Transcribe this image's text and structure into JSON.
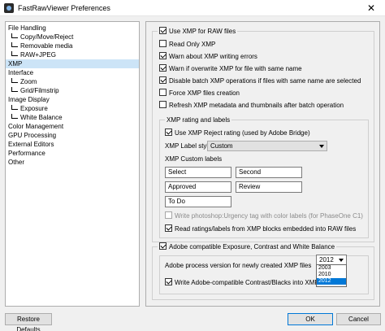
{
  "window": {
    "title": "FastRawViewer Preferences",
    "close": "✕"
  },
  "tree": [
    {
      "label": "File Handling",
      "child": false
    },
    {
      "label": "Copy/Move/Reject",
      "child": true
    },
    {
      "label": "Removable media",
      "child": true
    },
    {
      "label": "RAW+JPEG",
      "child": true
    },
    {
      "label": "XMP",
      "child": false,
      "selected": true
    },
    {
      "label": "Interface",
      "child": false
    },
    {
      "label": "Zoom",
      "child": true
    },
    {
      "label": "Grid/Filmstrip",
      "child": true
    },
    {
      "label": "Image Display",
      "child": false
    },
    {
      "label": "Exposure",
      "child": true
    },
    {
      "label": "White Balance",
      "child": true
    },
    {
      "label": "Color Management",
      "child": false
    },
    {
      "label": "GPU Processing",
      "child": false
    },
    {
      "label": "External Editors",
      "child": false
    },
    {
      "label": "Performance",
      "child": false
    },
    {
      "label": "Other",
      "child": false
    }
  ],
  "xmp": {
    "use_xmp": {
      "label": "Use XMP for RAW files",
      "checked": true
    },
    "options": [
      {
        "label": "Read Only XMP",
        "checked": false
      },
      {
        "label": "Warn about XMP writing errors",
        "checked": true
      },
      {
        "label": "Warn if overwrite XMP for file with same name",
        "checked": true
      },
      {
        "label": "Disable batch XMP operations if files with same name are selected",
        "checked": true
      },
      {
        "label": "Force XMP files creation",
        "checked": false
      },
      {
        "label": "Refresh XMP metadata and thumbnails after batch operation",
        "checked": false
      }
    ],
    "rating": {
      "title": "XMP rating and labels",
      "reject": {
        "label": "Use XMP Reject rating (used by Adobe Bridge)",
        "checked": true
      },
      "label_style_label": "XMP Label style",
      "label_style_value": "Custom",
      "custom_labels_title": "XMP Custom labels",
      "custom_labels": [
        "Select",
        "Second",
        "Approved",
        "Review",
        "To Do"
      ],
      "urgency": {
        "label": "Write photoshop:Urgency tag with color labels (for PhaseOne C1)",
        "checked": false
      },
      "read_ratings": {
        "label": "Read ratings/labels from XMP blocks embedded into RAW files",
        "checked": true
      }
    },
    "adobe": {
      "title": {
        "label": "Adobe compatible Exposure, Contrast and White Balance",
        "checked": true
      },
      "process_label": "Adobe process version for newly created XMP files",
      "process_value": "2012",
      "process_options": [
        "2003",
        "2010",
        "2012"
      ],
      "write_contrast": {
        "label": "Write Adobe-compatible Contrast/Blacks into XMP files",
        "checked": true
      }
    }
  },
  "buttons": {
    "restore": "Restore Defaults",
    "ok": "OK",
    "cancel": "Cancel"
  }
}
